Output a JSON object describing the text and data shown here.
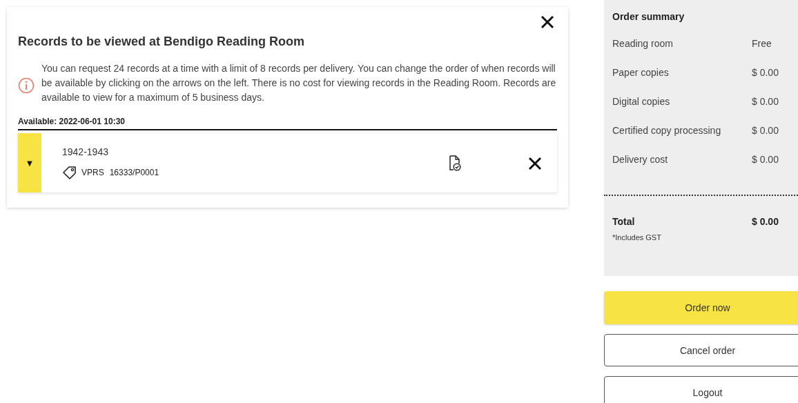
{
  "records_panel": {
    "title": "Records to be viewed at Bendigo Reading Room",
    "info": "You can request 24 records at a time with a limit of 8 records per delivery. You can change the order of when records will be available by clicking on the arrows on the left. There is no cost for viewing records in the Reading Room. Records are available to view for a maximum of 5 business days.",
    "groups": [
      {
        "available": "Available: 2022-06-01 10:30",
        "records": [
          {
            "handle": "▼",
            "dates": "1942-1943",
            "series": "VPRS",
            "reference": "16333/P0001"
          }
        ]
      }
    ]
  },
  "order_summary": {
    "title": "Order summary",
    "lines": [
      {
        "label": "Reading room",
        "value": "Free"
      },
      {
        "label": "Paper copies",
        "value": "$ 0.00"
      },
      {
        "label": "Digital copies",
        "value": "$ 0.00"
      },
      {
        "label": "Certified copy processing",
        "value": "$ 0.00"
      },
      {
        "label": "Delivery cost",
        "value": "$ 0.00"
      }
    ],
    "total_label": "Total",
    "total_value": "$ 0.00",
    "note": "*Includes GST"
  },
  "buttons": [
    {
      "label": "Order now",
      "kind": "primary"
    },
    {
      "label": "Cancel order",
      "kind": "secondary"
    },
    {
      "label": "Logout",
      "kind": "secondary"
    }
  ]
}
